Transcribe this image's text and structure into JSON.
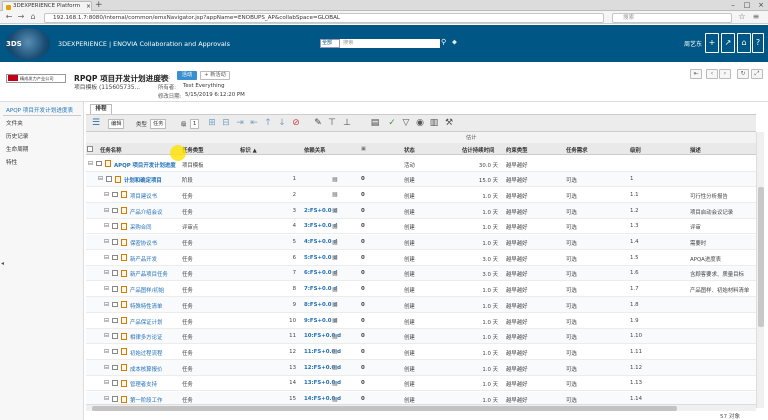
{
  "browser": {
    "tab_title": "3DEXPERIENCE Platform",
    "url": "192.168.1.7:8080/internal/common/emxNavigator.jsp?appName=ENOBUPS_AP&collabSpace=GLOBAL",
    "search_placeholder": "搜索"
  },
  "app": {
    "title": "3DEXPERIENCE | ENOVIA Collaboration and Approvals",
    "logo_text": "3DS",
    "scope_label": "全部",
    "search_placeholder": "搜索",
    "user": "周艺东"
  },
  "header": {
    "company": "精成发力产业公司",
    "title": "RPQP 项目开发计划进度表",
    "number_label": "项目模板",
    "number_value": "(115605735...",
    "state_label": "状态:",
    "state_value": "活动",
    "promote_label": "+ 新活动",
    "owner_label": "所有者:",
    "owner_value": "Test Everything",
    "modified_label": "修改日期:",
    "modified_value": "5/15/2019 6:12:20 PM"
  },
  "left_nav": {
    "items": [
      "APQP 项目开发计划进度表",
      "文件夹",
      "历史记录",
      "生命周期",
      "特性"
    ]
  },
  "subtab": "排程",
  "toolbar": {
    "mode_value": "编辑",
    "type_label": "类型",
    "type_value": "任务",
    "level_label": "级",
    "level_value": "1"
  },
  "table": {
    "subheader": "估计",
    "columns": [
      "任务名称",
      "任务类型",
      "标识 ▲",
      "依赖关系",
      "",
      "状态",
      "估计持续时间",
      "约束类型",
      "任务需求",
      "级别",
      "描述"
    ],
    "rows": [
      {
        "name": "APQP 项目开发计划进度",
        "type": "项目模板",
        "id": "",
        "dep": "",
        "n": "",
        "state": "活动",
        "dur": "30.0 天",
        "constraint": "越早越好",
        "req": "",
        "level": "",
        "desc": ""
      },
      {
        "name": "计划和确定项目",
        "type": "阶段",
        "id": "1",
        "dep": "",
        "n": "0",
        "state": "创建",
        "dur": "15.0 天",
        "constraint": "越早越好",
        "req": "可选",
        "level": "1",
        "desc": ""
      },
      {
        "name": "项目建议书",
        "type": "任务",
        "id": "2",
        "dep": "",
        "n": "0",
        "state": "创建",
        "dur": "1.0 天",
        "constraint": "越早越好",
        "req": "可选",
        "level": "1.1",
        "desc": "可行性分析报告"
      },
      {
        "name": "产品介绍会议",
        "type": "任务",
        "id": "3",
        "dep": "2:FS+0.0 d",
        "n": "0",
        "state": "创建",
        "dur": "1.0 天",
        "constraint": "越早越好",
        "req": "可选",
        "level": "1.2",
        "desc": "项目启动会议记录"
      },
      {
        "name": "采购合同",
        "type": "评审点",
        "id": "4",
        "dep": "3:FS+0.0 d",
        "n": "0",
        "state": "创建",
        "dur": "1.0 天",
        "constraint": "越早越好",
        "req": "可选",
        "level": "1.3",
        "desc": "评审"
      },
      {
        "name": "保密协议书",
        "type": "任务",
        "id": "5",
        "dep": "4:FS+0.0 d",
        "n": "0",
        "state": "创建",
        "dur": "1.0 天",
        "constraint": "越早越好",
        "req": "可选",
        "level": "1.4",
        "desc": "需要时"
      },
      {
        "name": "新产品开发",
        "type": "任务",
        "id": "6",
        "dep": "5:FS+0.0 d",
        "n": "0",
        "state": "创建",
        "dur": "3.0 天",
        "constraint": "越早越好",
        "req": "可选",
        "level": "1.5",
        "desc": "APQA进度表"
      },
      {
        "name": "新产品项目任务",
        "type": "任务",
        "id": "7",
        "dep": "6:FS+0.0 d",
        "n": "0",
        "state": "创建",
        "dur": "3.0 天",
        "constraint": "越早越好",
        "req": "可选",
        "level": "1.6",
        "desc": "含顾客要求、质量目标"
      },
      {
        "name": "产品图样/初始",
        "type": "任务",
        "id": "8",
        "dep": "7:FS+0.0 d",
        "n": "0",
        "state": "创建",
        "dur": "1.0 天",
        "constraint": "越早越好",
        "req": "可选",
        "level": "1.7",
        "desc": "产品图样、初始材料清单"
      },
      {
        "name": "特殊特性清单",
        "type": "任务",
        "id": "9",
        "dep": "8:FS+0.0 d",
        "n": "0",
        "state": "创建",
        "dur": "1.0 天",
        "constraint": "越早越好",
        "req": "可选",
        "level": "1.8",
        "desc": ""
      },
      {
        "name": "产品保证计划",
        "type": "任务",
        "id": "10",
        "dep": "9:FS+0.0 d",
        "n": "0",
        "state": "创建",
        "dur": "1.0 天",
        "constraint": "越早越好",
        "req": "可选",
        "level": "1.9",
        "desc": ""
      },
      {
        "name": "相律多方论证",
        "type": "任务",
        "id": "11",
        "dep": "10:FS+0.0 d",
        "n": "0",
        "state": "创建",
        "dur": "1.0 天",
        "constraint": "越早越好",
        "req": "可选",
        "level": "1.10",
        "desc": ""
      },
      {
        "name": "初始过程流程",
        "type": "任务",
        "id": "12",
        "dep": "11:FS+0.0 d",
        "n": "0",
        "state": "创建",
        "dur": "1.0 天",
        "constraint": "越早越好",
        "req": "可选",
        "level": "1.11",
        "desc": ""
      },
      {
        "name": "成本核算报价",
        "type": "任务",
        "id": "13",
        "dep": "12:FS+0.0 d",
        "n": "0",
        "state": "创建",
        "dur": "1.0 天",
        "constraint": "越早越好",
        "req": "可选",
        "level": "1.12",
        "desc": ""
      },
      {
        "name": "管理者支持",
        "type": "任务",
        "id": "14",
        "dep": "13:FS+0.0 d",
        "n": "0",
        "state": "创建",
        "dur": "1.0 天",
        "constraint": "越早越好",
        "req": "可选",
        "level": "1.13",
        "desc": ""
      },
      {
        "name": "第一阶段工作",
        "type": "任务",
        "id": "15",
        "dep": "14:FS+0.0 d",
        "n": "0",
        "state": "创建",
        "dur": "1.0 天",
        "constraint": "越早越好",
        "req": "可选",
        "level": "1.14",
        "desc": ""
      }
    ]
  },
  "footer": {
    "count": "57 对象"
  },
  "colors": {
    "app_bar": "#005685",
    "link": "#1f6fb8",
    "state_button": "#3a8fcf"
  }
}
